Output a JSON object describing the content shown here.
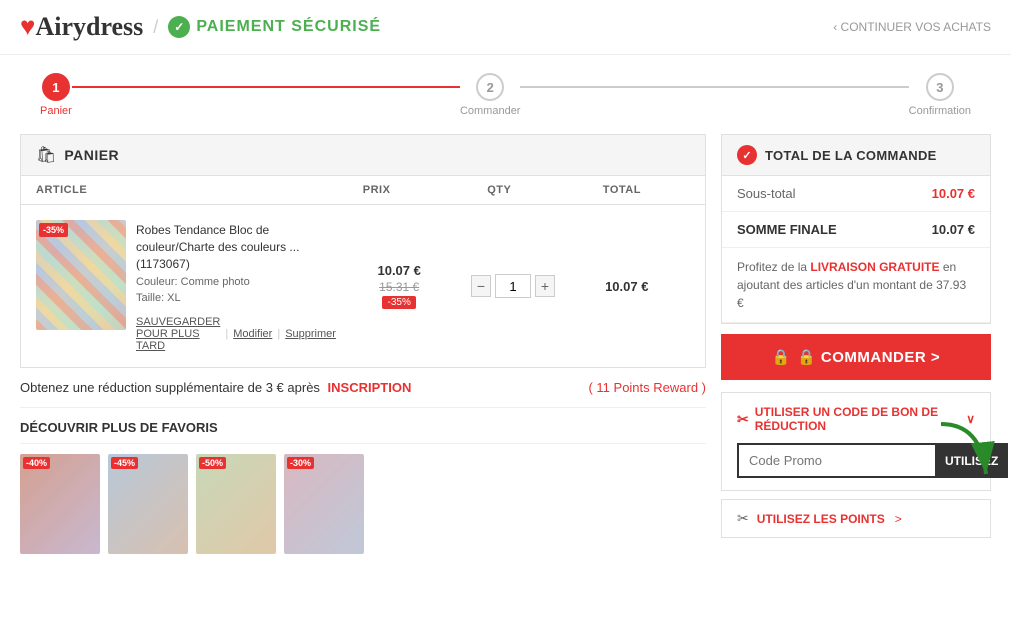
{
  "header": {
    "logo": "Airydress",
    "logo_heart": "♥",
    "slash": "/",
    "secure_icon": "✓",
    "secure_text": "PAIEMENT SÉCURISÉ",
    "continue_link": "‹ CONTINUER VOS ACHATS"
  },
  "steps": [
    {
      "number": "1",
      "label": "Panier",
      "active": true
    },
    {
      "number": "2",
      "label": "Commander",
      "active": false
    },
    {
      "number": "3",
      "label": "Confirmation",
      "active": false
    }
  ],
  "cart": {
    "section_title": "PANIER",
    "bag_icon": "🛍",
    "columns": [
      "ARTICLE",
      "PRIX",
      "QTY",
      "TOTAL"
    ],
    "items": [
      {
        "name": "Robes Tendance Bloc de couleur/Charte des couleurs ... (1173067)",
        "color": "Couleur: Comme photo",
        "size": "Taille: XL",
        "original_price": "15.31 €",
        "current_price": "10.07 €",
        "discount": "-35%",
        "qty": "1",
        "total": "10.07 €",
        "save_label": "SAUVEGARDER POUR PLUS TARD",
        "modify_label": "Modifier",
        "delete_label": "Supprimer"
      }
    ]
  },
  "reward_bar": {
    "text_before": "Obtenez une réduction supplémentaire de 3 € après",
    "inscription_link": "INSCRIPTION",
    "points_text": "( 11 Points Reward )"
  },
  "discover": {
    "title": "DÉCOUVRIR PLUS DE FAVORIS",
    "badges": [
      "-40%",
      "-45%",
      "-50%",
      "-30%"
    ]
  },
  "order_summary": {
    "title": "TOTAL DE LA COMMANDE",
    "icon": "✓",
    "sous_total_label": "Sous-total",
    "sous_total_value": "10.07 €",
    "somme_finale_label": "SOMME FINALE",
    "somme_finale_value": "10.07 €",
    "free_shipping_text_before": "Profitez de la",
    "free_shipping_link": "LIVRAISON GRATUITE",
    "free_shipping_text_after": "en ajoutant des articles d'un montant de 37.93 €",
    "commander_label": "🔒 COMMANDER >"
  },
  "promo": {
    "icon": "✂",
    "title": "UTILISER UN CODE DE BON DE RÉDUCTION",
    "chevron": "∨",
    "placeholder": "Code Promo",
    "button_label": "UTILISEZ"
  },
  "points": {
    "icon": "✂",
    "label": "UTILISEZ LES POINTS",
    "arrow": ">"
  }
}
